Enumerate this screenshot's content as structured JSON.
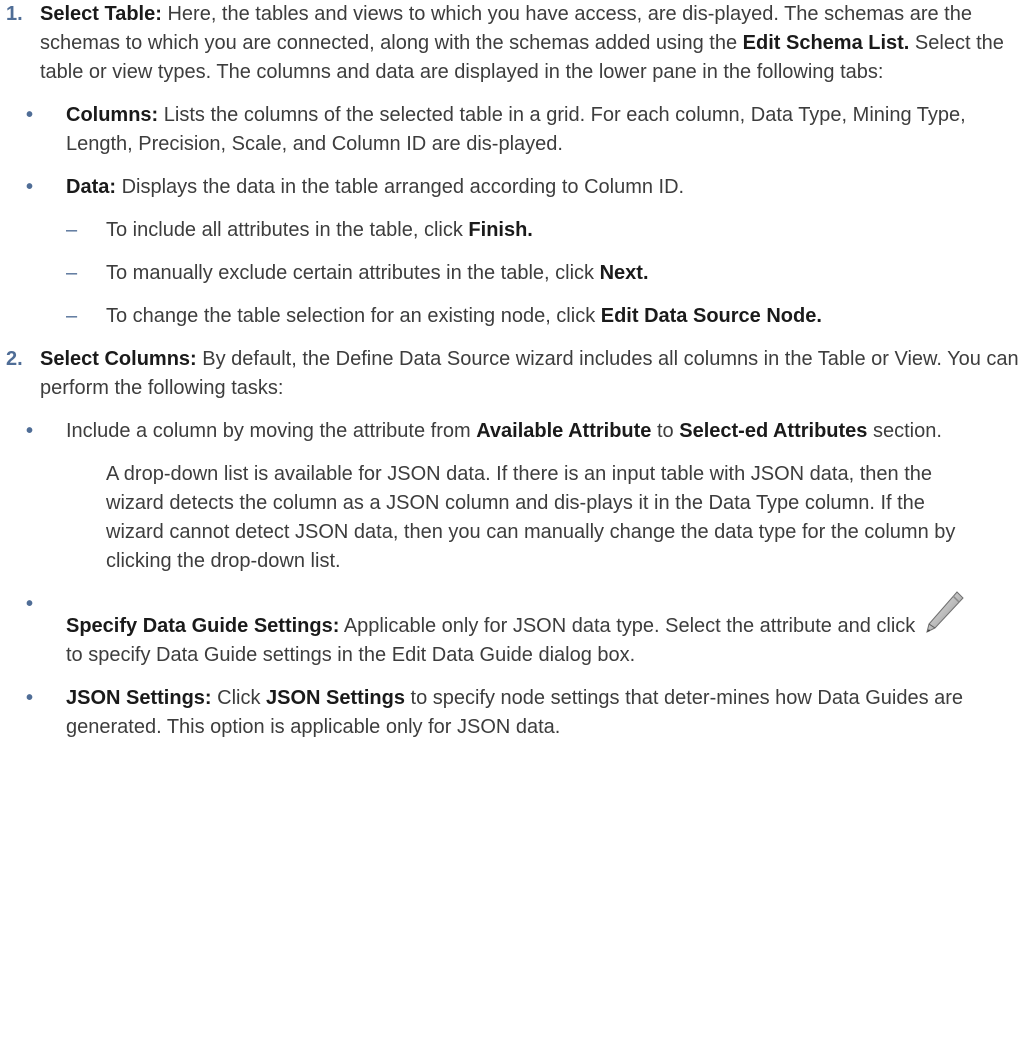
{
  "item1": {
    "num": "1.",
    "lead": "Select Table:",
    "text_a": " Here, the tables and views to which you have access, are dis-played. The schemas are the schemas to which you are connected, along with the schemas added using the ",
    "bold_a": "Edit Schema List.",
    "text_b": " Select the table or view types. The columns and data are displayed in the lower pane in the following tabs:",
    "columns": {
      "lead": "Columns:",
      "text": " Lists the columns of the selected table in a grid. For each column, Data Type, Mining Type, Length, Precision, Scale, and Column ID are dis-played."
    },
    "data": {
      "lead": "Data:",
      "text": " Displays the data in the table arranged according to Column ID."
    },
    "dash1": {
      "text": "To include all attributes in the table, click ",
      "bold": "Finish."
    },
    "dash2": {
      "text": "To manually exclude certain attributes in the table, click ",
      "bold": "Next."
    },
    "dash3": {
      "text": "To change the table selection for an existing node, click ",
      "bold": "Edit Data Source Node."
    }
  },
  "item2": {
    "num": "2.",
    "lead": "Select Columns:",
    "text": " By default, the Define Data Source wizard includes all columns in the Table or View. You can perform the following tasks:",
    "include": {
      "text_a": "Include a column by moving the attribute from ",
      "bold_a": "Available Attribute",
      "text_b": " to ",
      "bold_b": "Select-ed Attributes",
      "text_c": " section."
    },
    "json_para": "A drop-down list is available for JSON data. If there is an input table with JSON data, then the wizard detects the column as a JSON column and dis-plays it in the Data Type column. If the wizard cannot detect JSON data, then you can manually change the data type for the column by clicking the drop-down list.",
    "guide": {
      "lead": "Specify Data Guide Settings:",
      "text_a": " Applicable only for JSON data type. Select the attribute and click ",
      "icon": "pencil-edit-icon",
      "text_b": " to specify Data Guide settings in the Edit Data Guide dialog box."
    },
    "json_settings": {
      "lead": "JSON Settings:",
      "text_a": " Click ",
      "bold": "JSON Settings",
      "text_b": " to specify node settings that deter-mines how Data Guides are generated. This option is applicable only for JSON data."
    }
  },
  "bullet_symbol": "•",
  "dash_symbol": "–",
  "colors": {
    "marker": "#4f6d96",
    "text": "#3d3d3d",
    "bold": "#1a1a1a"
  }
}
